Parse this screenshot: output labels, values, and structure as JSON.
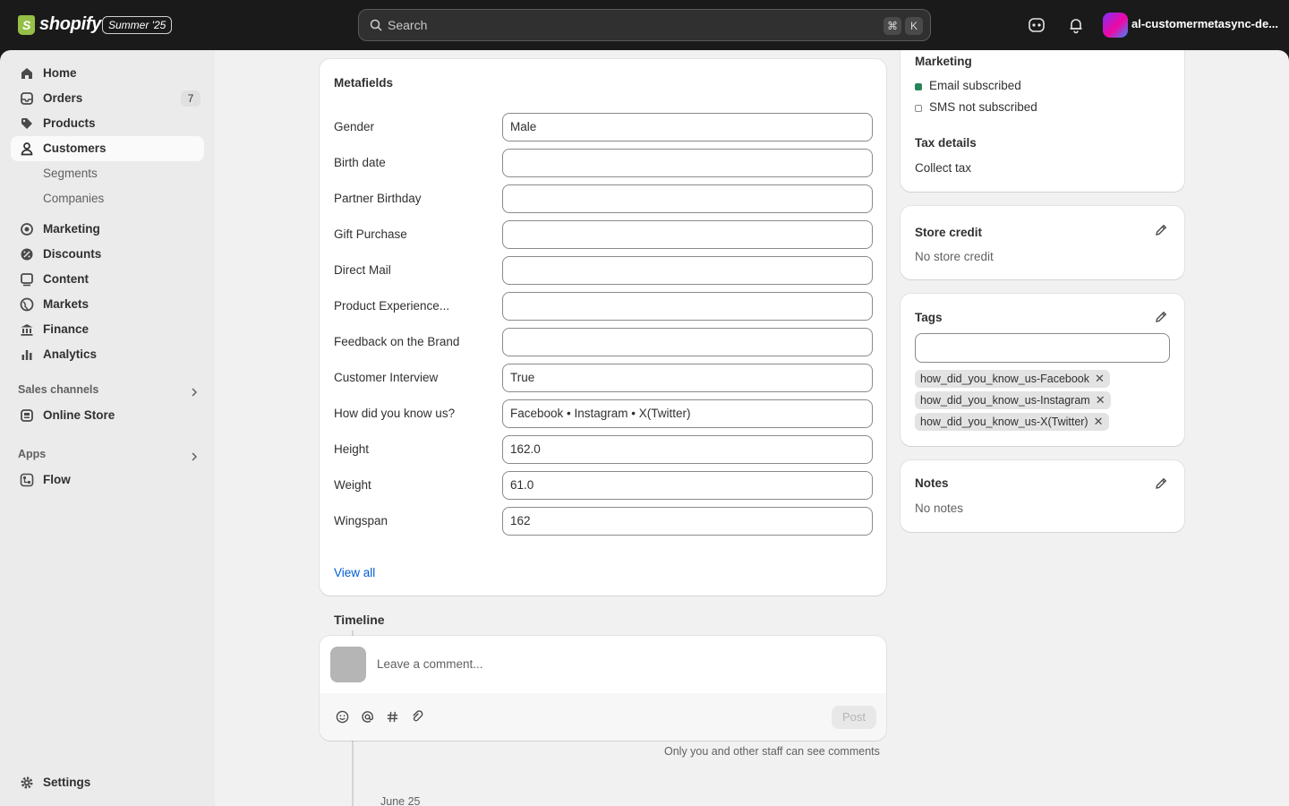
{
  "topbar": {
    "logo_text": "shopify",
    "edition": "Summer '25",
    "search_placeholder": "Search",
    "kbd_cmd": "⌘",
    "kbd_k": "K",
    "store_name": "al-customermetasync-de..."
  },
  "sidebar": {
    "items": [
      {
        "label": "Home",
        "icon": "home-icon"
      },
      {
        "label": "Orders",
        "icon": "orders-icon",
        "badge": "7"
      },
      {
        "label": "Products",
        "icon": "tag-icon"
      },
      {
        "label": "Customers",
        "icon": "person-icon"
      },
      {
        "label": "Marketing",
        "icon": "target-icon"
      },
      {
        "label": "Discounts",
        "icon": "discount-icon"
      },
      {
        "label": "Content",
        "icon": "content-icon"
      },
      {
        "label": "Markets",
        "icon": "globe-icon"
      },
      {
        "label": "Finance",
        "icon": "bank-icon"
      },
      {
        "label": "Analytics",
        "icon": "bar-chart-icon"
      }
    ],
    "sub_items": [
      "Segments",
      "Companies"
    ],
    "sales_channels_label": "Sales channels",
    "online_store_label": "Online Store",
    "apps_label": "Apps",
    "flow_label": "Flow",
    "settings_label": "Settings"
  },
  "metafields": {
    "title": "Metafields",
    "fields": [
      {
        "label": "Gender",
        "value": "Male"
      },
      {
        "label": "Birth date",
        "value": ""
      },
      {
        "label": "Partner Birthday",
        "value": ""
      },
      {
        "label": "Gift Purchase",
        "value": ""
      },
      {
        "label": "Direct Mail",
        "value": ""
      },
      {
        "label": "Product Experience...",
        "value": ""
      },
      {
        "label": "Feedback on the Brand",
        "value": ""
      },
      {
        "label": "Customer Interview",
        "value": "True"
      },
      {
        "label": "How did you know us?",
        "value": "Facebook • Instagram • X(Twitter)"
      },
      {
        "label": "Height",
        "value": "162.0"
      },
      {
        "label": "Weight",
        "value": "61.0"
      },
      {
        "label": "Wingspan",
        "value": "162"
      }
    ],
    "view_all": "View all"
  },
  "timeline": {
    "title": "Timeline",
    "comment_placeholder": "Leave a comment...",
    "post_label": "Post",
    "staff_note": "Only you and other staff can see comments",
    "date": "June 25"
  },
  "marketing": {
    "title": "Marketing",
    "email_status": "Email subscribed",
    "sms_status": "SMS not subscribed",
    "tax_title": "Tax details",
    "tax_value": "Collect tax",
    "email_color": "#29845a"
  },
  "store_credit": {
    "title": "Store credit",
    "value": "No store credit"
  },
  "tags": {
    "title": "Tags",
    "input_value": "",
    "items": [
      "how_did_you_know_us-Facebook",
      "how_did_you_know_us-Instagram",
      "how_did_you_know_us-X(Twitter)"
    ]
  },
  "notes": {
    "title": "Notes",
    "value": "No notes"
  }
}
